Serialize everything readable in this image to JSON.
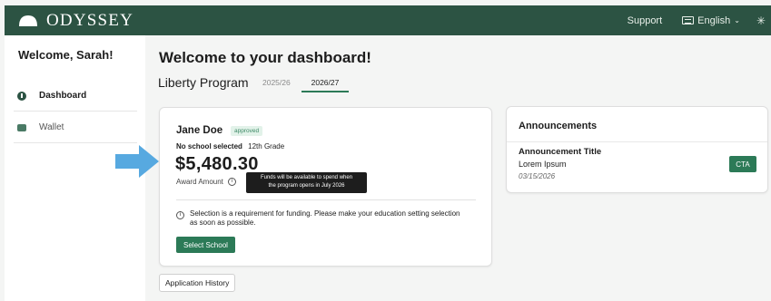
{
  "brand": {
    "name": "ODYSSEY"
  },
  "topbar": {
    "support_label": "Support",
    "language_label": "English",
    "chevron_glyph": "⌄",
    "settings_glyph": "✳"
  },
  "sidebar": {
    "welcome": "Welcome, Sarah!",
    "items": [
      {
        "label": "Dashboard",
        "icon": "dashboard-icon",
        "active": true
      },
      {
        "label": "Wallet",
        "icon": "wallet-icon",
        "active": false
      }
    ]
  },
  "main": {
    "title": "Welcome to your dashboard!",
    "program": "Liberty Program",
    "tabs": [
      {
        "label": "2025/26",
        "selected": false
      },
      {
        "label": "2026/27",
        "selected": true
      }
    ]
  },
  "award_card": {
    "student_name": "Jane Doe",
    "status": "approved",
    "school_status": "No school selected",
    "grade": "12th Grade",
    "amount": "$5,480.30",
    "amount_label": "Award Amount",
    "info_glyph": "i",
    "tooltip_line1": "Funds will be available to spend when",
    "tooltip_line2": "the program opens in July 2026",
    "notice": "Selection is a requirement for funding. Please make your education setting selection as soon as possible.",
    "select_button": "Select School"
  },
  "announcements": {
    "title": "Announcements",
    "item_title": "Announcement Title",
    "item_body": "Lorem Ipsum",
    "item_date": "03/15/2026",
    "cta_label": "CTA"
  },
  "history_button": "Application History",
  "colors": {
    "header_bg": "#2c5343",
    "accent": "#2c7a57",
    "arrow": "#57a9e0"
  }
}
